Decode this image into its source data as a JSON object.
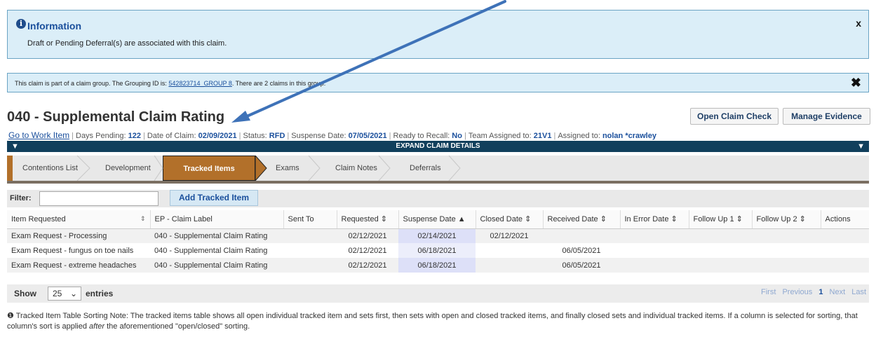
{
  "info": {
    "title": "Information",
    "message": "Draft or Pending Deferral(s) are associated with this claim.",
    "close": "x"
  },
  "group_notice": {
    "prefix": "This claim is part of a claim group. The Grouping ID is: ",
    "grouping_id": "542823714_GROUP 8",
    "suffix": ". There are 2 claims in this group.",
    "close": "✖"
  },
  "header": {
    "title": "040 - Supplemental Claim Rating",
    "open_claim_check": "Open Claim Check",
    "manage_evidence": "Manage Evidence"
  },
  "meta": {
    "go_to_work_item": "Go to Work Item",
    "days_pending_label": "Days Pending: ",
    "days_pending": "122",
    "date_of_claim_label": "Date of Claim: ",
    "date_of_claim": "02/09/2021",
    "status_label": "Status: ",
    "status": "RFD",
    "suspense_date_label": "Suspense Date: ",
    "suspense_date": "07/05/2021",
    "ready_to_recall_label": "Ready to Recall: ",
    "ready_to_recall": "No",
    "team_label": "Team Assigned to: ",
    "team": "21V1",
    "assigned_label": "Assigned to: ",
    "assigned": "nolan *crawley"
  },
  "expand_label": "EXPAND CLAIM DETAILS",
  "steps": [
    "Contentions List",
    "Development",
    "Tracked Items",
    "Exams",
    "Claim Notes",
    "Deferrals"
  ],
  "filter": {
    "label": "Filter:",
    "value": "",
    "add_button": "Add Tracked Item"
  },
  "table": {
    "columns": [
      "Item Requested",
      "EP - Claim Label",
      "Sent To",
      "Requested",
      "Suspense Date",
      "Closed Date",
      "Received Date",
      "In Error Date",
      "Follow Up 1",
      "Follow Up 2",
      "Actions"
    ],
    "rows": [
      [
        "Exam Request - Processing",
        "040 - Supplemental Claim Rating",
        "",
        "02/12/2021",
        "02/14/2021",
        "02/12/2021",
        "",
        "",
        "",
        "",
        ""
      ],
      [
        "Exam Request - fungus on toe nails",
        "040 - Supplemental Claim Rating",
        "",
        "02/12/2021",
        "06/18/2021",
        "",
        "06/05/2021",
        "",
        "",
        "",
        ""
      ],
      [
        "Exam Request - extreme headaches",
        "040 - Supplemental Claim Rating",
        "",
        "02/12/2021",
        "06/18/2021",
        "",
        "06/05/2021",
        "",
        "",
        "",
        ""
      ]
    ]
  },
  "footer": {
    "show": "Show",
    "entries_value": "25",
    "entries": "entries",
    "pager": [
      "First",
      "Previous",
      "1",
      "Next",
      "Last"
    ]
  },
  "note": {
    "part1": "Tracked Item Table Sorting Note: The tracked items table shows all open individual tracked item and sets first, then sets with open and closed tracked items, and finally closed sets and individual tracked items. If a column is selected for sorting, that column's sort is applied ",
    "emph": "after",
    "part2": " the aforementioned \"open/closed\" sorting."
  },
  "colors": {
    "accent": "#b2702a",
    "banner": "#113f5c",
    "info_bg": "#dbeef8",
    "link": "#1a4f9c"
  }
}
